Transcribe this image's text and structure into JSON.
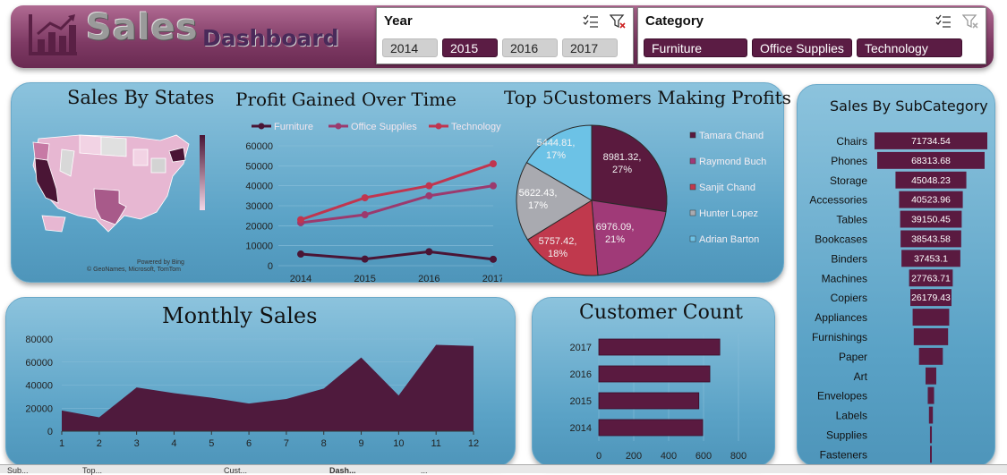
{
  "header": {
    "title_main": "Sales",
    "title_sub": "Dashboard",
    "year_slicer": {
      "title": "Year",
      "items": [
        {
          "label": "2014",
          "selected": false
        },
        {
          "label": "2015",
          "selected": true
        },
        {
          "label": "2016",
          "selected": false
        },
        {
          "label": "2017",
          "selected": false
        }
      ]
    },
    "category_slicer": {
      "title": "Category",
      "items": [
        {
          "label": "Furniture",
          "selected": true
        },
        {
          "label": "Office Supplies",
          "selected": true
        },
        {
          "label": "Technology",
          "selected": true
        }
      ]
    }
  },
  "colors": {
    "dark": "#4a1535",
    "mid": "#9b3a6e",
    "red": "#c0354f",
    "panel": "#6aaed0"
  },
  "map": {
    "title": "Sales By States",
    "credit1": "Powered by Bing",
    "credit2": "© GeoNames, Microsoft, TomTom"
  },
  "panels": {
    "profit_title": "Profit Gained Over Time",
    "customers_title": "Top 5Customers Making Profits",
    "monthly_title": "Monthly Sales",
    "count_title": "Customer Count",
    "subcat_title": "Sales By SubCategory"
  },
  "chart_data": [
    {
      "type": "line",
      "title": "Profit Gained Over Time",
      "x": [
        "2014",
        "2015",
        "2016",
        "2017"
      ],
      "ylim": [
        0,
        60000
      ],
      "yticks": [
        "0",
        "10000",
        "20000",
        "30000",
        "40000",
        "50000",
        "60000"
      ],
      "series": [
        {
          "name": "Furniture",
          "color": "#4a1535",
          "values": [
            5800,
            3300,
            7000,
            3200
          ]
        },
        {
          "name": "Office Supplies",
          "color": "#9b3a6e",
          "values": [
            21500,
            25500,
            35000,
            40000
          ]
        },
        {
          "name": "Technology",
          "color": "#c0354f",
          "values": [
            23000,
            34000,
            40000,
            51000
          ]
        }
      ]
    },
    {
      "type": "pie",
      "title": "Top 5Customers Making Profits",
      "slices": [
        {
          "name": "Tamara Chand",
          "value": 8981.32,
          "label": "8981.32,",
          "pct": "27%",
          "color": "#5a1a3e"
        },
        {
          "name": "Raymond Buch",
          "value": 6976.09,
          "label": "6976.09,",
          "pct": "21%",
          "color": "#a03a78"
        },
        {
          "name": "Sanjit Chand",
          "value": 5757.42,
          "label": "5757.42,",
          "pct": "18%",
          "color": "#c0394d"
        },
        {
          "name": "Hunter Lopez",
          "value": 5622.43,
          "label": "5622.43,",
          "pct": "17%",
          "color": "#a9aab0"
        },
        {
          "name": "Adrian Barton",
          "value": 5444.81,
          "label": "5444.81,",
          "pct": "17%",
          "color": "#6cc2e6"
        }
      ]
    },
    {
      "type": "area",
      "title": "Monthly Sales",
      "x": [
        "1",
        "2",
        "3",
        "4",
        "5",
        "6",
        "7",
        "8",
        "9",
        "10",
        "11",
        "12"
      ],
      "values": [
        18000,
        12000,
        38000,
        33000,
        29000,
        24000,
        28000,
        37000,
        64000,
        31000,
        75000,
        74000
      ],
      "ylim": [
        0,
        80000
      ],
      "yticks": [
        "0",
        "20000",
        "40000",
        "60000",
        "80000"
      ]
    },
    {
      "type": "bar",
      "title": "Customer Count",
      "categories": [
        "2017",
        "2016",
        "2015",
        "2014"
      ],
      "values": [
        693,
        636,
        573,
        595
      ],
      "xlim": [
        0,
        800
      ],
      "xticks": [
        "0",
        "200",
        "400",
        "600",
        "800"
      ]
    },
    {
      "type": "bar",
      "title": "Sales By SubCategory",
      "categories": [
        "Chairs",
        "Phones",
        "Storage",
        "Accessories",
        "Tables",
        "Bookcases",
        "Binders",
        "Machines",
        "Copiers",
        "Appliances",
        "Furnishings",
        "Paper",
        "Art",
        "Envelopes",
        "Labels",
        "Supplies",
        "Fasteners"
      ],
      "values": [
        71734.54,
        68313.68,
        45048.23,
        40523.96,
        39150.45,
        38543.58,
        37453.1,
        27763.71,
        26179.43,
        23241.26,
        21855.5,
        15150,
        6800,
        4000,
        2500,
        1200,
        300
      ],
      "labels": [
        "71734.54",
        "68313.68",
        "45048.23",
        "40523.96",
        "39150.45",
        "38543.58",
        "37453.1",
        "27763.71",
        "26179.43",
        "",
        "",
        "",
        "",
        "",
        "",
        "",
        ""
      ]
    }
  ]
}
